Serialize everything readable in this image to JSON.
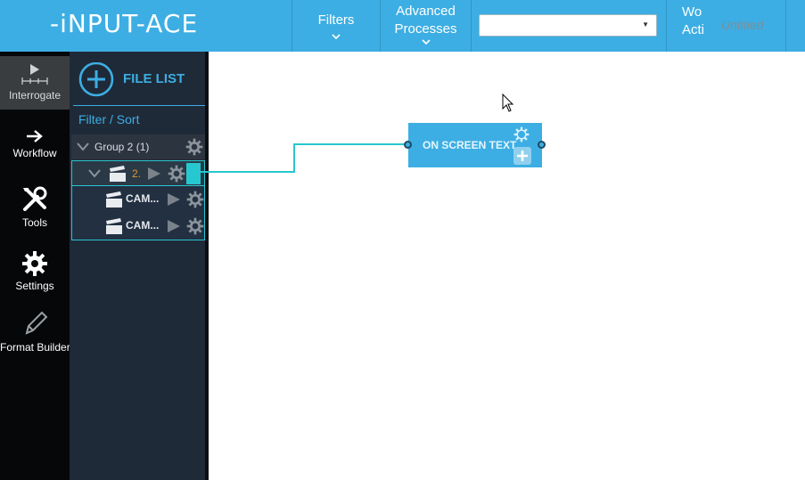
{
  "app": {
    "logo": "-iNPUT-ACE",
    "accent": "#3daee3",
    "teal": "#27c7cf"
  },
  "topbar": {
    "filters_label": "Filters",
    "advanced_line1": "Advanced",
    "advanced_line2": "Processes",
    "dropdown_value": "",
    "work_label_partial_1": "Wo",
    "work_label_partial_2": "Acti",
    "document_title": "Untitled"
  },
  "leftnav": {
    "items": [
      {
        "label": "Interrogate",
        "icon": "play-timeline-icon"
      },
      {
        "label": "Workflow",
        "icon": "arrow-right-icon"
      },
      {
        "label": "Tools",
        "icon": "tools-icon"
      },
      {
        "label": "Settings",
        "icon": "gear-icon"
      },
      {
        "label": "Format Builder",
        "icon": "pencil-icon"
      }
    ]
  },
  "filelist": {
    "title": "FILE LIST",
    "filter_label": "Filter / Sort",
    "group_label": "Group 2 (1)",
    "selected_item_label": "2.",
    "cam_items": [
      "CAM...",
      "CAM..."
    ]
  },
  "canvas": {
    "node_title": "ON SCREEN TEXT"
  }
}
